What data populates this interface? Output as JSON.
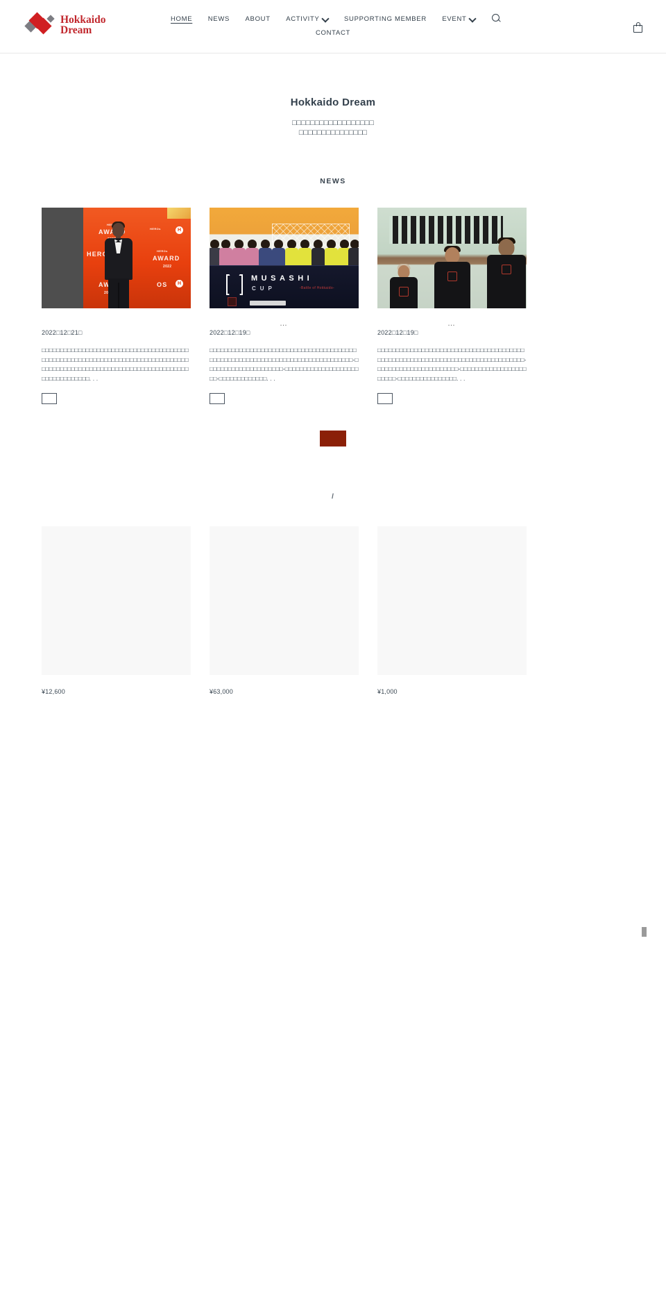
{
  "header": {
    "logo": {
      "line1": "Hokkaido",
      "line2": "Dream",
      "name": "hokkaido-dream-logo"
    },
    "nav": [
      {
        "label": "HOME",
        "active": true,
        "dropdown": false
      },
      {
        "label": "NEWS",
        "active": false,
        "dropdown": false
      },
      {
        "label": "ABOUT",
        "active": false,
        "dropdown": false
      },
      {
        "label": "ACTIVITY",
        "active": false,
        "dropdown": true
      },
      {
        "label": "SUPPORTING MEMBER",
        "active": false,
        "dropdown": false
      },
      {
        "label": "EVENT",
        "active": false,
        "dropdown": true
      },
      {
        "label": "CONTACT",
        "active": false,
        "dropdown": false
      }
    ],
    "search_icon": "search-icon",
    "cart_icon": "shopping-bag-icon"
  },
  "hero": {
    "title": "Hokkaido Dream",
    "subtitle_line1": "□□□□□□□□□□□□□□□□□□",
    "subtitle_line2": "□□□□□□□□□□□□□□□"
  },
  "news": {
    "heading": "NEWS",
    "cards": [
      {
        "image_alt": "heros-award-red-carpet-photo",
        "ellipsis": "",
        "date": "2022□12□21□",
        "excerpt": "□□□□□□□□□□□□□□□□□□□□□□□□□□□□□□□□□□□□□□□□□□□□□□□□□□□□□□□□□□□□□□□□□□□□□□□□□□□□□□□□□□□□□□□□□□□□□□□□□□□□□□□□□□□□□□□□□□□□□□□□□□□□□□□□□□□□□. . .",
        "more_label": ""
      },
      {
        "image_alt": "musashi-cup-team-banner-photo",
        "ellipsis": "…",
        "date": "2022□12□19□",
        "excerpt": "□□□□□□□□□□□□□□□□□□□□□□□□□□□□□□□□□□□□□□□□□□□□□□□□□□□□□□□□□□□□□□□□□□□□□□□□□□□□□□□-□□□□□□□□□□□□□□□□□□□□□-□□□□□□□□□□□□□□□□□□□□□□-□□□□□□□□□□□□□. . .",
        "more_label": ""
      },
      {
        "image_alt": "gym-players-black-jersey-photo",
        "ellipsis": "…",
        "date": "2022□12□19□",
        "excerpt": "□□□□□□□□□□□□□□□□□□□□□□□□□□□□□□□□□□□□□□□□□□□□□□□□□□□□□□□□□□□□□□□□□□□□□□□□□□□□□□□□-□□□□□□□□□□□□□□□□□□□□□□-□□□□□□□□□□□□□□□□□□□□□□□-□□□□□□□□□□□□□□□□. . .",
        "more_label": ""
      }
    ],
    "more_button_label": "",
    "more_button_color": "#8b2008"
  },
  "shop": {
    "heading": "/",
    "products": [
      {
        "image_alt": "product-image-placeholder",
        "price": "¥12,600"
      },
      {
        "image_alt": "product-image-placeholder",
        "price": "¥63,000"
      },
      {
        "image_alt": "product-image-placeholder",
        "price": "¥1,000"
      }
    ]
  },
  "colors": {
    "logo_red": "#c1272d",
    "accent_red": "#8b2008",
    "text": "#3a4752",
    "border": "#e8e8e8"
  }
}
